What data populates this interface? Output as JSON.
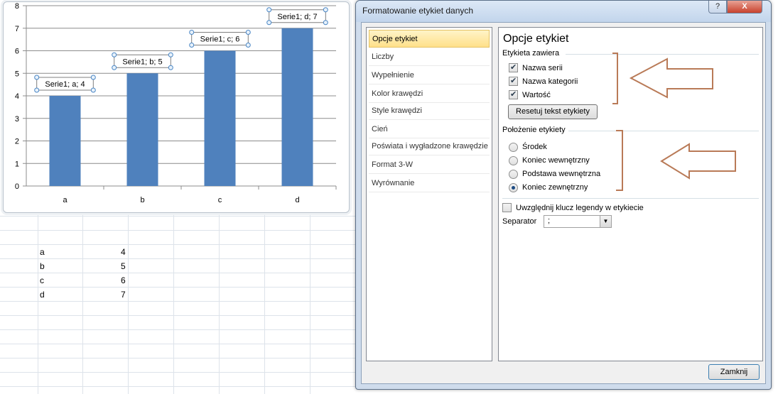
{
  "sheet": {
    "rows": [
      {
        "label": "a",
        "value": "4"
      },
      {
        "label": "b",
        "value": "5"
      },
      {
        "label": "c",
        "value": "6"
      },
      {
        "label": "d",
        "value": "7"
      }
    ]
  },
  "chart_data": {
    "type": "bar",
    "categories": [
      "a",
      "b",
      "c",
      "d"
    ],
    "series": [
      {
        "name": "Serie1",
        "values": [
          4,
          5,
          6,
          7
        ]
      }
    ],
    "data_labels": [
      "Serie1; a; 4",
      "Serie1; b; 5",
      "Serie1; c; 6",
      "Serie1; d; 7"
    ],
    "y_ticks": [
      "0",
      "1",
      "2",
      "3",
      "4",
      "5",
      "6",
      "7",
      "8"
    ],
    "ylim": [
      0,
      8
    ],
    "grid": true,
    "bar_color": "#4f81bd"
  },
  "dialog": {
    "title": "Formatowanie etykiet danych",
    "help_icon": "?",
    "close_icon": "X",
    "nav": [
      {
        "label": "Opcje etykiet",
        "selected": true
      },
      {
        "label": "Liczby"
      },
      {
        "label": "Wypełnienie"
      },
      {
        "label": "Kolor krawędzi"
      },
      {
        "label": "Style krawędzi"
      },
      {
        "label": "Cień"
      },
      {
        "label": "Poświata i wygładzone krawędzie"
      },
      {
        "label": "Format 3-W"
      },
      {
        "label": "Wyrównanie"
      }
    ],
    "panel_title": "Opcje etykiet",
    "contains_heading": "Etykieta zawiera",
    "checkboxes": [
      {
        "label": "Nazwa serii",
        "checked": true
      },
      {
        "label": "Nazwa kategorii",
        "checked": true
      },
      {
        "label": "Wartość",
        "checked": true
      }
    ],
    "reset_button": "Resetuj tekst etykiety",
    "position_heading": "Położenie etykiety",
    "radios": [
      {
        "label": "Środek",
        "checked": false
      },
      {
        "label": "Koniec wewnętrzny",
        "checked": false
      },
      {
        "label": "Podstawa wewnętrzna",
        "checked": false
      },
      {
        "label": "Koniec zewnętrzny",
        "checked": true
      }
    ],
    "legend_key_label": "Uwzględnij klucz legendy w etykiecie",
    "legend_key_checked": false,
    "separator_label": "Separator",
    "separator_value": ";",
    "close_button": "Zamknij"
  },
  "annotation_color": "#b97a57"
}
